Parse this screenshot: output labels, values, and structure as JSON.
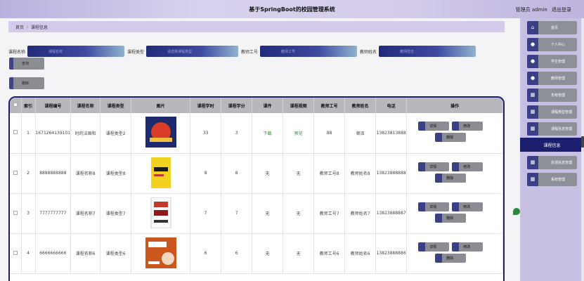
{
  "header": {
    "title": "基于SpringBoot的校园管理系统",
    "role": "管理员 admin",
    "logout": "退出登录"
  },
  "breadcrumb": {
    "home": "首页",
    "separator": "⁝",
    "current": "课程信息"
  },
  "search": {
    "fields": [
      {
        "label": "课程名称",
        "placeholder": "课程名称"
      },
      {
        "label": "课程类型",
        "placeholder": "请选择课程类型"
      },
      {
        "label": "教师工号",
        "placeholder": "教师工号"
      },
      {
        "label": "教师姓名",
        "placeholder": "教师姓名"
      }
    ],
    "query_button": "查询",
    "delete_button": "删除"
  },
  "table": {
    "headers": [
      "",
      "索引",
      "课程编号",
      "课程名称",
      "课程类型",
      "图片",
      "课程学时",
      "课程学分",
      "课件",
      "课程视频",
      "教师工号",
      "教师姓名",
      "电话",
      "操作"
    ],
    "rows": [
      {
        "index": "1",
        "code": "1671264139101",
        "name": "时的法国和",
        "type": "课程类型2",
        "hours": "33",
        "credits": "3",
        "courseware": "下载",
        "video": "预览",
        "teacher_id": "88",
        "teacher_name": "顿泽",
        "phone": "13823813888",
        "image": "red-blue-book"
      },
      {
        "index": "2",
        "code": "8888888888",
        "name": "课程名称8",
        "type": "课程类型8",
        "hours": "8",
        "credits": "8",
        "courseware": "无",
        "video": "无",
        "teacher_id": "教师工号8",
        "teacher_name": "教师姓名8",
        "phone": "13823888888",
        "image": "yellow-book"
      },
      {
        "index": "3",
        "code": "7777777777",
        "name": "课程名称7",
        "type": "课程类型7",
        "hours": "7",
        "credits": "7",
        "courseware": "无",
        "video": "无",
        "teacher_id": "教师工号7",
        "teacher_name": "教师姓名7",
        "phone": "13823888887",
        "image": "white-red-book"
      },
      {
        "index": "4",
        "code": "6666666666",
        "name": "课程名称6",
        "type": "课程类型6",
        "hours": "6",
        "credits": "6",
        "courseware": "无",
        "video": "无",
        "teacher_id": "教师工号6",
        "teacher_name": "教师姓名6",
        "phone": "13823888886",
        "image": "orange-book"
      }
    ],
    "op_labels": {
      "detail": "详情",
      "edit": "修改",
      "delete": "删除"
    }
  },
  "sidebar": {
    "items": [
      {
        "label": "首页",
        "icon": "home-icon"
      },
      {
        "label": "个人中心",
        "icon": "user-icon"
      },
      {
        "label": "学生管理",
        "icon": "user-icon"
      },
      {
        "label": "教师管理",
        "icon": "user-icon"
      },
      {
        "label": "年级管理",
        "icon": "grid-icon"
      },
      {
        "label": "课程类型管理",
        "icon": "grid-icon"
      },
      {
        "label": "课程信息管理",
        "icon": "grid-icon"
      },
      {
        "label": "课程信息",
        "icon": "",
        "active": true
      },
      {
        "label": "反馈信息管理",
        "icon": "grid-icon"
      },
      {
        "label": "系统管理",
        "icon": "grid-icon"
      }
    ]
  },
  "colors": {
    "accent_dark": "#1b1f6e",
    "header_bg": "#d3cbe9",
    "sidebar_bg": "#c7c0e2",
    "green_link": "#2a8b3c"
  }
}
